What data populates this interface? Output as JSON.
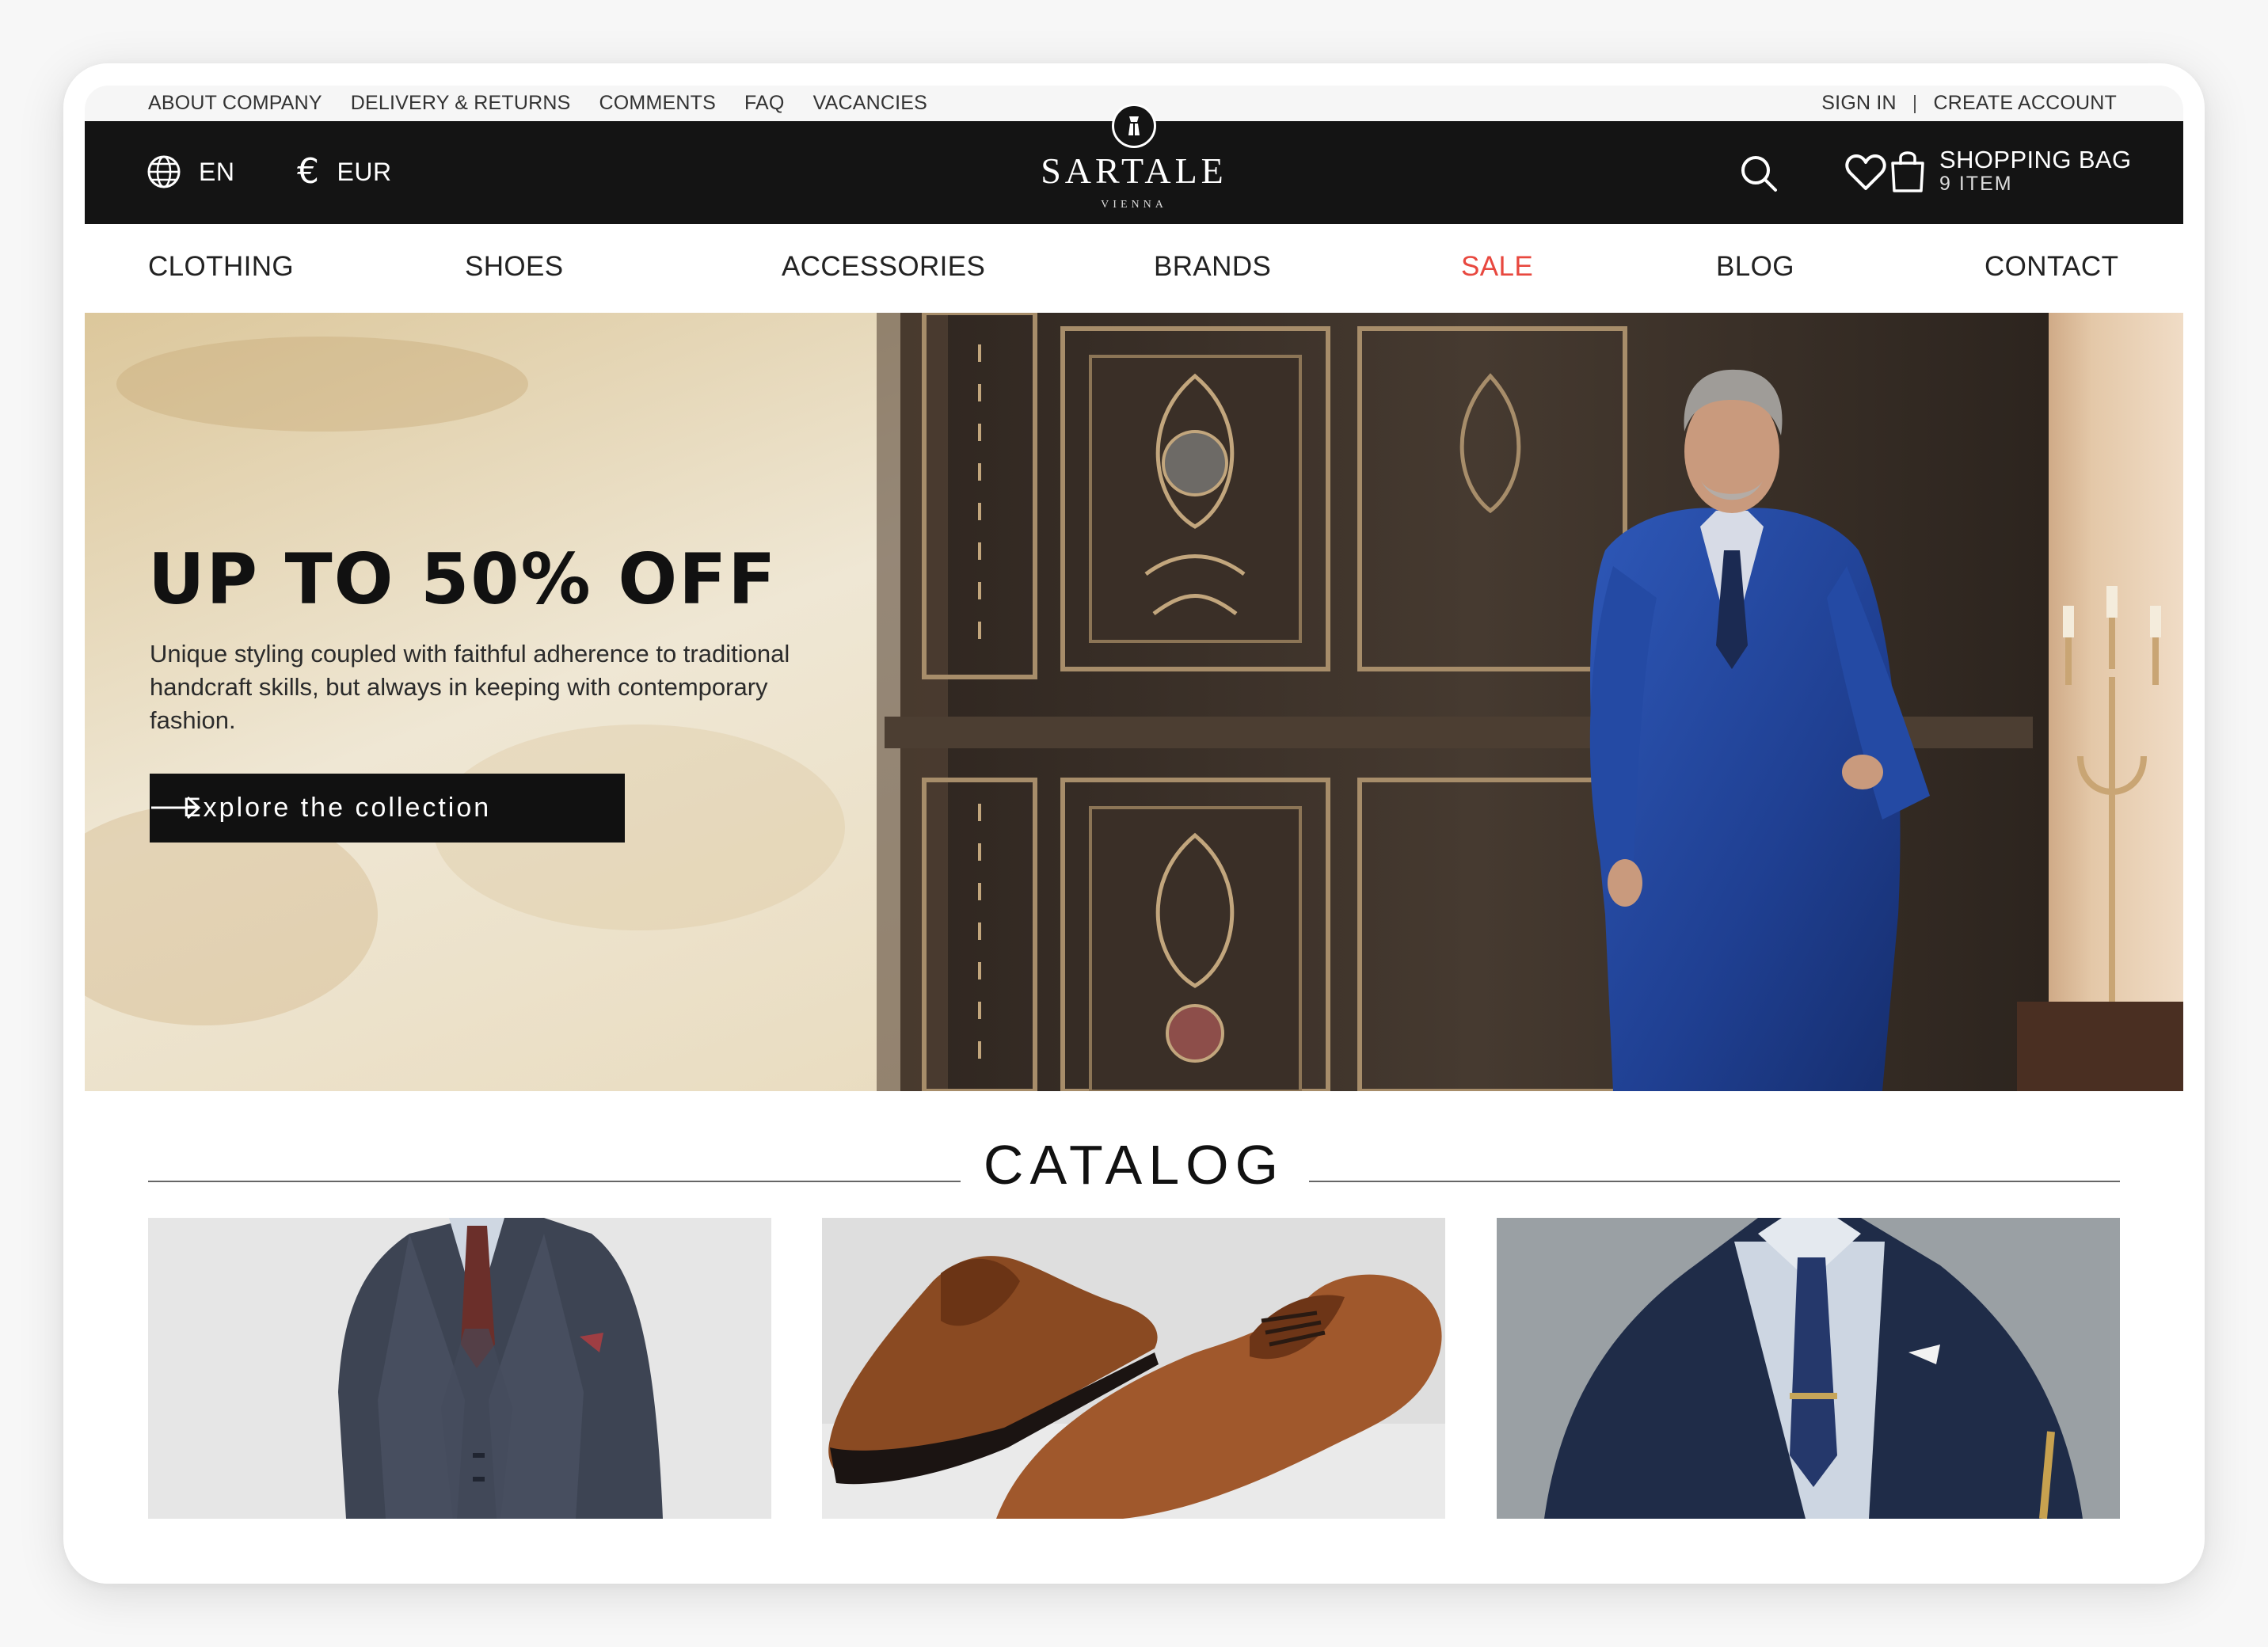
{
  "topbar": {
    "links": [
      "ABOUT COMPANY",
      "DELIVERY & RETURNS",
      "COMMENTS",
      "FAQ",
      "VACANCIES"
    ],
    "sign_in": "SIGN IN",
    "separator": "|",
    "create_account": "CREATE ACCOUNT"
  },
  "header": {
    "language": "EN",
    "currency_symbol": "€",
    "currency": "EUR",
    "logo": "SARTALE",
    "logo_sub": "VIENNA",
    "bag_label": "SHOPPING BAG",
    "bag_count": "9 ITEM",
    "icons": [
      "globe-icon",
      "search-icon",
      "heart-icon",
      "shopping-bag-icon"
    ]
  },
  "nav": {
    "items": [
      "CLOTHING",
      "SHOES",
      "ACCESSORIES",
      "BRANDS",
      "SALE",
      "BLOG",
      "CONTACT"
    ]
  },
  "hero": {
    "title": "UP TO 50% OFF",
    "description": "Unique styling coupled with faithful adherence to traditional handcraft skills, but always in keeping with contemporary fashion.",
    "cta": "Explore the collection"
  },
  "catalog": {
    "title": "CATALOG"
  },
  "colors": {
    "header_bg": "#141414",
    "sale": "#e8483f",
    "text": "#111111"
  }
}
